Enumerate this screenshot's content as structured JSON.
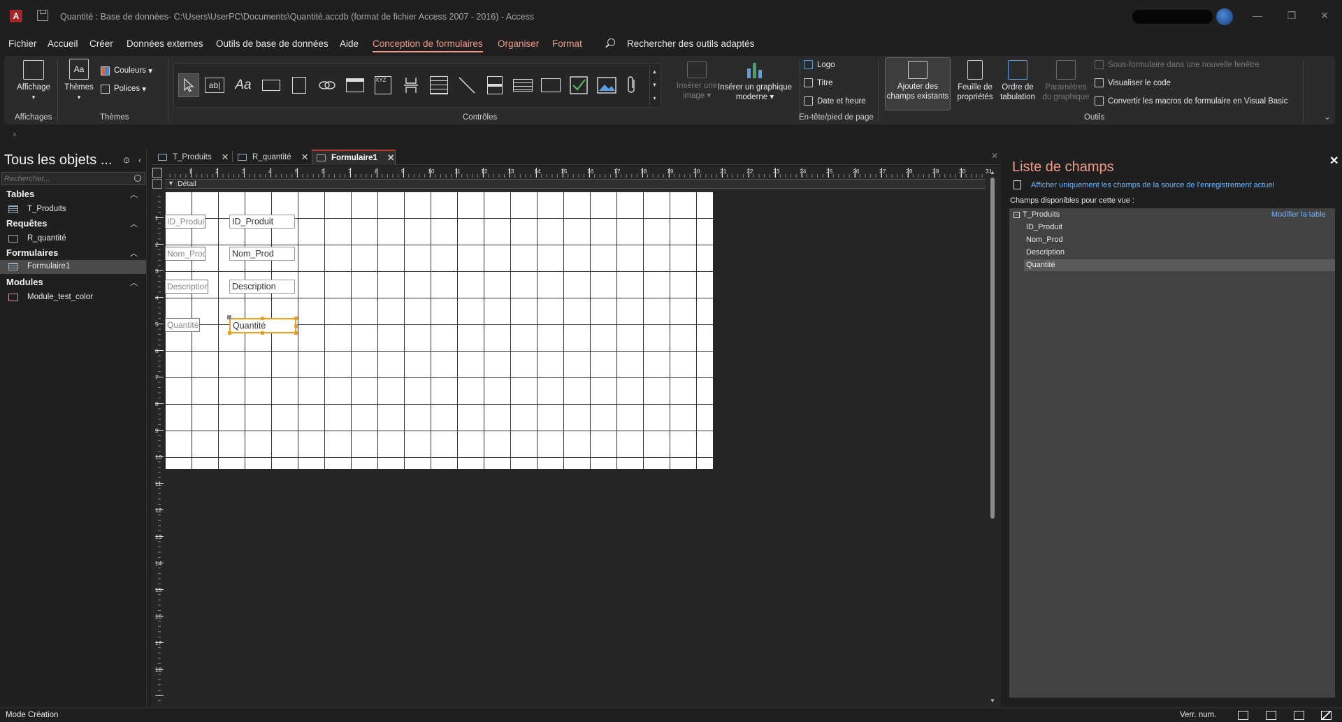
{
  "window": {
    "title": "Quantité : Base de données- C:\\Users\\UserPC\\Documents\\Quantité.accdb (format de fichier Access 2007 - 2016)  -  Access",
    "minimize_glyph": "—",
    "restore_glyph": "❐",
    "close_glyph": "✕"
  },
  "menu": {
    "items": [
      "Fichier",
      "Accueil",
      "Créer",
      "Données externes",
      "Outils de base de données",
      "Aide",
      "Conception de formulaires",
      "Organiser",
      "Format"
    ],
    "active": "Conception de formulaires",
    "search_label": "Rechercher des outils adaptés"
  },
  "ribbon": {
    "groups": {
      "affichages": "Affichages",
      "themes": "Thèmes",
      "controles": "Contrôles",
      "entete": "En-tête/pied de page",
      "outils": "Outils"
    },
    "affichage_label": "Affichage",
    "themes_label": "Thèmes",
    "couleurs_label": "Couleurs",
    "polices_label": "Polices",
    "inserer_image_line1": "Insérer une",
    "inserer_image_line2": "image",
    "inserer_graphique_line1": "Insérer un graphique",
    "inserer_graphique_line2": "moderne",
    "logo_label": "Logo",
    "titre_label": "Titre",
    "date_heure_label": "Date et heure",
    "ajouter_champs_line1": "Ajouter des",
    "ajouter_champs_line2": "champs existants",
    "feuille_prop_line1": "Feuille de",
    "feuille_prop_line2": "propriétés",
    "ordre_tab_line1": "Ordre de",
    "ordre_tab_line2": "tabulation",
    "param_graph_line1": "Paramètres",
    "param_graph_line2": "du graphique",
    "sous_formulaire": "Sous-formulaire dans une nouvelle fenêtre",
    "visualiser_code": "Visualiser le code",
    "convertir_macros": "Convertir les macros de formulaire en Visual Basic",
    "label_glyph": "Aa",
    "textbox_glyph": "ab|",
    "qat_glyph": "⩡"
  },
  "navpane": {
    "title": "Tous les objets ...",
    "search_placeholder": "Rechercher...",
    "categories": [
      {
        "name": "Tables",
        "items": [
          "T_Produits"
        ]
      },
      {
        "name": "Requêtes",
        "items": [
          "R_quantité"
        ]
      },
      {
        "name": "Formulaires",
        "items": [
          "Formulaire1"
        ]
      },
      {
        "name": "Modules",
        "items": [
          "Module_test_color"
        ]
      }
    ],
    "selected_item": "Formulaire1"
  },
  "document": {
    "tabs": [
      {
        "label": "T_Produits",
        "active": false
      },
      {
        "label": "R_quantité",
        "active": false
      },
      {
        "label": "Formulaire1",
        "active": true
      }
    ],
    "section_label": "Détail",
    "hruler_numbers": [
      "1",
      "2",
      "3",
      "4",
      "5",
      "6",
      "7",
      "8",
      "9",
      "10",
      "11",
      "12",
      "13",
      "14",
      "15",
      "16",
      "17",
      "18",
      "19",
      "20",
      "21",
      "22",
      "23",
      "24",
      "25",
      "26",
      "27",
      "28",
      "29",
      "30",
      "31"
    ],
    "vruler_numbers": [
      "1",
      "2",
      "3",
      "4",
      "5",
      "6",
      "7",
      "8",
      "9",
      "10",
      "11",
      "12",
      "13",
      "14",
      "15",
      "16",
      "17",
      "18"
    ],
    "controls": [
      {
        "label": "ID_Produit",
        "field": "ID_Produit"
      },
      {
        "label": "Nom_Prod",
        "field": "Nom_Prod"
      },
      {
        "label": "Description",
        "field": "Description"
      },
      {
        "label": "Quantité",
        "field": "Quantité"
      }
    ],
    "selected_control": "Quantité"
  },
  "fieldlist": {
    "title": "Liste de champs",
    "show_only_link": "Afficher uniquement les champs de la source de l'enregistrement actuel",
    "available_label": "Champs disponibles pour cette vue :",
    "table_name": "T_Produits",
    "edit_table_link": "Modifier la table",
    "fields": [
      "ID_Produit",
      "Nom_Prod",
      "Description",
      "Quantité"
    ],
    "selected_field": "Quantité"
  },
  "status": {
    "mode": "Mode Création",
    "numlock": "Verr. num."
  }
}
